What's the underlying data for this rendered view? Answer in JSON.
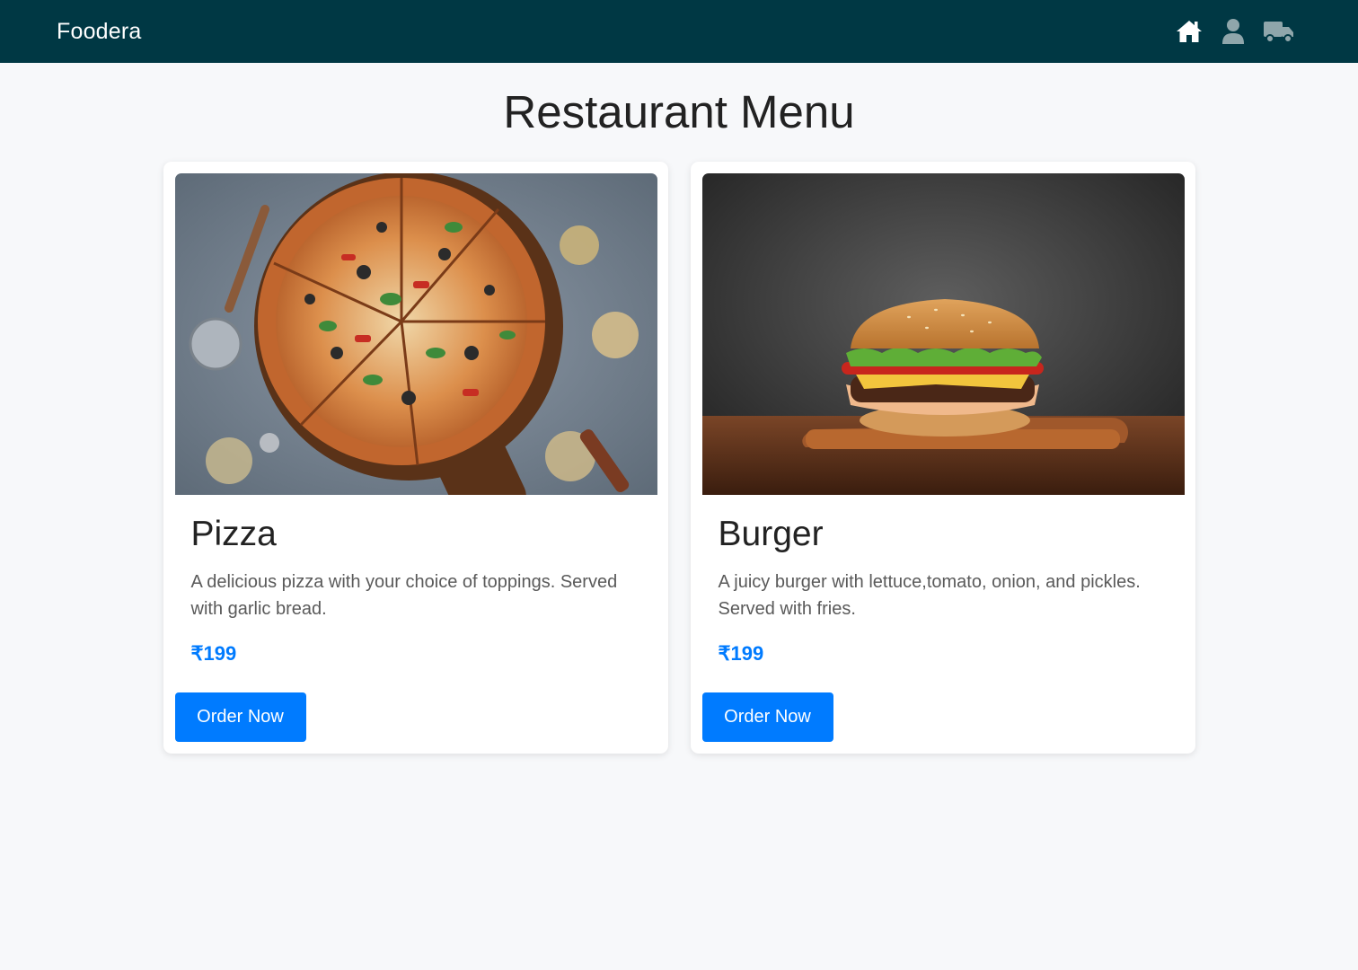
{
  "navbar": {
    "brand": "Foodera",
    "icons": [
      {
        "name": "home-icon",
        "color": "#ffffff"
      },
      {
        "name": "user-icon",
        "color": "#8fa6ab"
      },
      {
        "name": "truck-icon",
        "color": "#8fa6ab"
      }
    ],
    "background": "#003844"
  },
  "main": {
    "title": "Restaurant Menu"
  },
  "menu_items": [
    {
      "title": "Pizza",
      "description": "A delicious pizza with your choice of toppings. Served with garlic bread.",
      "price": "₹199",
      "button_label": "Order Now",
      "image": "pizza-image"
    },
    {
      "title": "Burger",
      "description": "A juicy burger with lettuce,tomato, onion, and pickles. Served with fries.",
      "price": "₹199",
      "button_label": "Order Now",
      "image": "burger-image"
    }
  ],
  "colors": {
    "accent": "#007bff",
    "page_background": "#f7f8fa"
  }
}
